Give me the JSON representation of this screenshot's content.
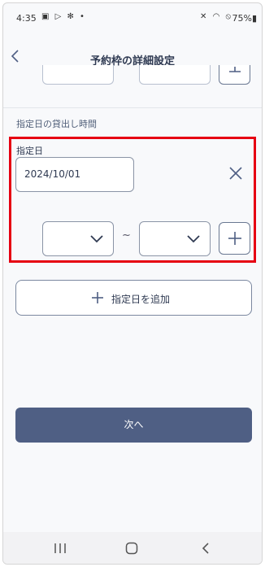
{
  "status": {
    "time": "4:35",
    "battery": "75%"
  },
  "header": {
    "title": "予約枠の詳細設定"
  },
  "section": {
    "title": "指定日の貸出し時間"
  },
  "specified_date": {
    "label": "指定日",
    "value": "2024/10/01",
    "from_value": "",
    "to_value": ""
  },
  "time_separator": "~",
  "buttons": {
    "add_date": "指定日を追加",
    "next": "次へ"
  },
  "colors": {
    "highlight": "#e60012",
    "primary": "#4f5f84"
  }
}
